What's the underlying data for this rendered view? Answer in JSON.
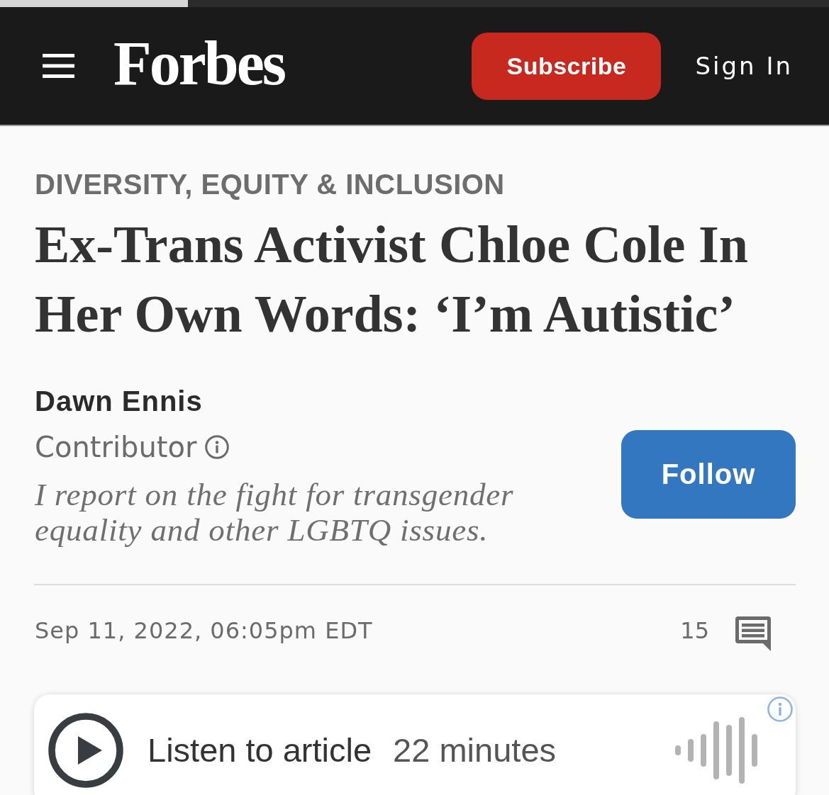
{
  "loading_bar": {
    "level": 0.227
  },
  "header": {
    "logo": "Forbes",
    "subscribe_button": "Subscribe",
    "sign_in": "Sign In"
  },
  "article": {
    "category": "DIVERSITY, EQUITY & INCLUSION",
    "title": "Ex-Trans Activist Chloe Cole In Her Own Words: ‘I’m Autistic’",
    "author": {
      "name": "Dawn Ennis",
      "role": "Contributor",
      "bio": "I report on the fight for transgender equality and other LGBTQ issues.",
      "follow_button": "Follow"
    },
    "date": "Sep 11, 2022, 06:05pm EDT",
    "comment_count": "15"
  },
  "audio_player": {
    "label": "Listen to article",
    "duration": "22 minutes"
  }
}
